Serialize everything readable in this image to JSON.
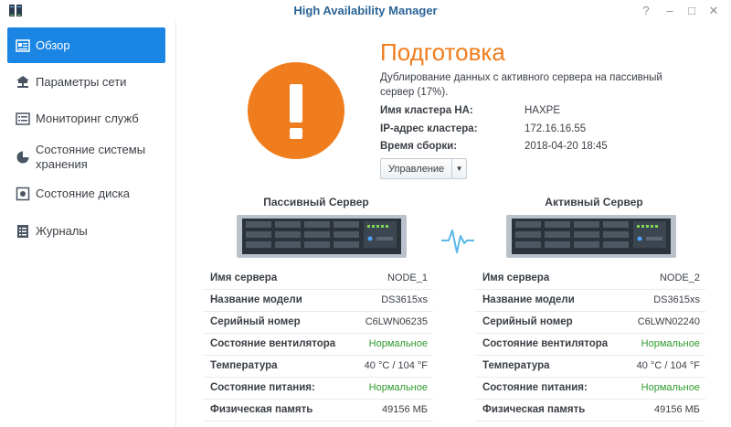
{
  "window": {
    "title": "High Availability Manager",
    "help": "?",
    "minimize": "–",
    "maximize": "□",
    "close": "✕"
  },
  "sidebar": {
    "items": [
      {
        "label": "Обзор",
        "icon": "overview-icon",
        "active": true
      },
      {
        "label": "Параметры сети",
        "icon": "network-icon"
      },
      {
        "label": "Мониторинг служб",
        "icon": "service-monitor-icon"
      },
      {
        "label": "Состояние системы хранения",
        "icon": "storage-status-icon"
      },
      {
        "label": "Состояние диска",
        "icon": "disk-icon"
      },
      {
        "label": "Журналы",
        "icon": "logs-icon"
      }
    ]
  },
  "status": {
    "title": "Подготовка",
    "description": "Дублирование данных с активного сервера на пассивный сервер (17%).",
    "progress_percent": 17,
    "color": "#f07d1d",
    "icon": "exclamation-icon",
    "cluster_name_label": "Имя кластера HA:",
    "cluster_name_value": "HAXPE",
    "cluster_ip_label": "IP-адрес кластера:",
    "cluster_ip_value": "172.16.16.55",
    "build_time_label": "Время сборки:",
    "build_time_value": "2018-04-20 18:45",
    "manage_button": "Управление"
  },
  "servers": {
    "passive": {
      "heading": "Пассивный Сервер",
      "rows": [
        {
          "label": "Имя сервера",
          "value": "NODE_1"
        },
        {
          "label": "Название модели",
          "value": "DS3615xs"
        },
        {
          "label": "Серийный номер",
          "value": "C6LWN06235"
        },
        {
          "label": "Состояние вентилятора",
          "value": "Нормальное",
          "ok": true
        },
        {
          "label": "Температура",
          "value": "40 °C / 104 °F"
        },
        {
          "label": "Состояние питания:",
          "value": "Нормальное",
          "ok": true
        },
        {
          "label": "Физическая память",
          "value": "49156 МБ"
        }
      ]
    },
    "active": {
      "heading": "Активный Сервер",
      "rows": [
        {
          "label": "Имя сервера",
          "value": "NODE_2"
        },
        {
          "label": "Название модели",
          "value": "DS3615xs"
        },
        {
          "label": "Серийный номер",
          "value": "C6LWN02240"
        },
        {
          "label": "Состояние вентилятора",
          "value": "Нормальное",
          "ok": true
        },
        {
          "label": "Температура",
          "value": "40 °C / 104 °F"
        },
        {
          "label": "Состояние питания:",
          "value": "Нормальное",
          "ok": true
        },
        {
          "label": "Физическая память",
          "value": "49156 МБ"
        }
      ]
    }
  },
  "colors": {
    "accent": "#1b85e4",
    "ok": "#2e9a2e",
    "warning": "#f07d1d",
    "heartbeat": "#5bb8e8"
  }
}
